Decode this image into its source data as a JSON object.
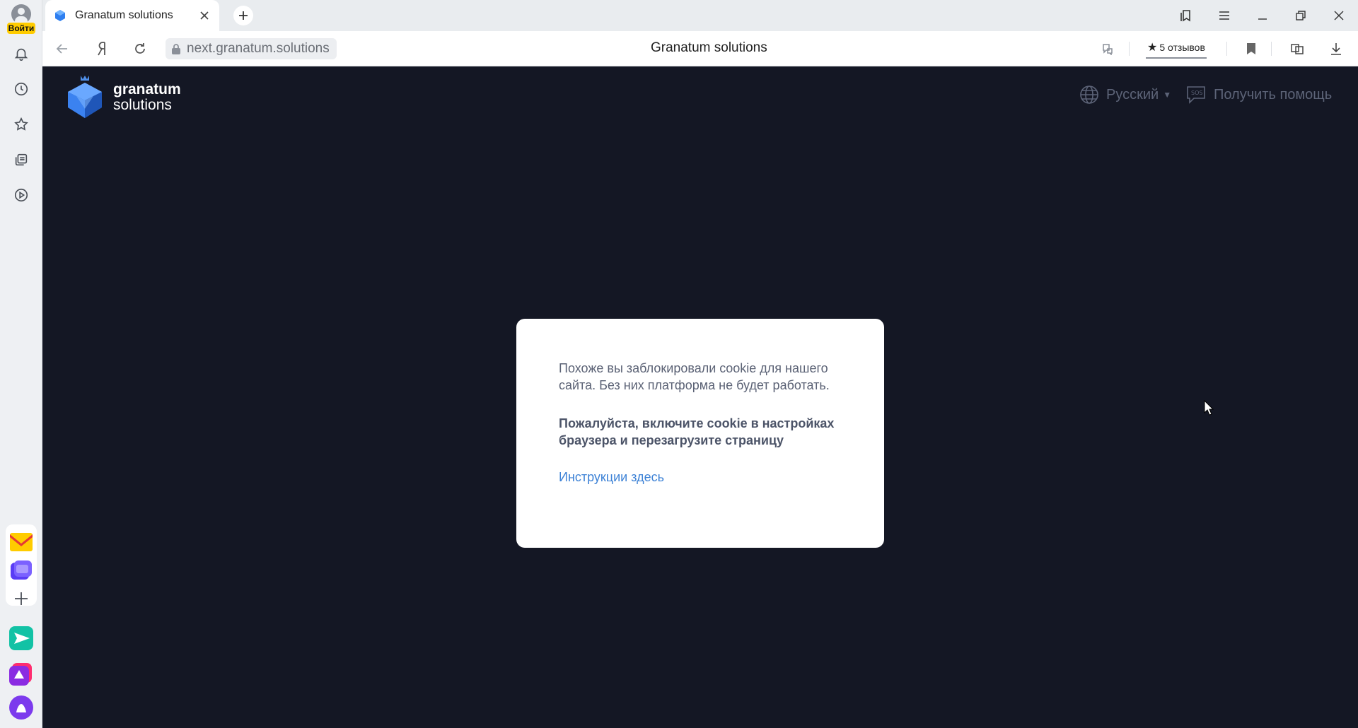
{
  "sidebar": {
    "login_label": "Войти",
    "icons": [
      "bell-icon",
      "history-icon",
      "star-icon",
      "collections-icon",
      "play-icon"
    ],
    "apps": [
      "mail-app",
      "messenger-app",
      "add-app",
      "send-app",
      "music-app",
      "alice-app"
    ]
  },
  "tabs": [
    {
      "title": "Granatum solutions"
    }
  ],
  "address_bar": {
    "url": "next.granatum.solutions",
    "page_title": "Granatum solutions",
    "reviews_label": "5 отзывов",
    "reviews_star": "★"
  },
  "page": {
    "logo": {
      "line1": "granatum",
      "line2": "solutions"
    },
    "language": "Русский",
    "help_label": "Получить помощь",
    "modal": {
      "message": "Похоже вы заблокировали cookie для нашего сайта. Без них платформа не будет работать.",
      "message_bold": "Пожалуйста, включите cookie в настройках браузера и перезагрузите страницу",
      "link": "Инструкции здесь"
    }
  },
  "colors": {
    "page_bg": "#141724",
    "modal_bg": "#ffffff",
    "link": "#3d82d6",
    "muted_text": "#5d6478",
    "login_badge": "#ffcc00"
  }
}
